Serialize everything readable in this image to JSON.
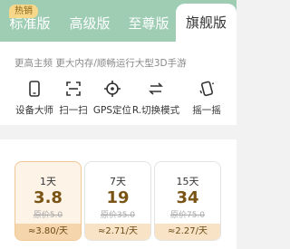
{
  "tabs": {
    "badge": "热销",
    "items": [
      "标准版",
      "高级版",
      "至尊版",
      "旗舰版"
    ],
    "active_index": 3
  },
  "info": {
    "tagline": "更高主频 更大内存/顺畅运行大型3D手游",
    "features": [
      {
        "label": "设备大师",
        "icon": "phone-icon"
      },
      {
        "label": "扫一扫",
        "icon": "scan-icon"
      },
      {
        "label": "GPS定位",
        "icon": "crosshair-icon"
      },
      {
        "label": "R.切换模式",
        "icon": "switch-icon"
      },
      {
        "label": "摇一摇",
        "icon": "shake-icon"
      }
    ]
  },
  "plans": [
    {
      "duration": "1天",
      "price": "3.8",
      "original": "原价5.0",
      "daily": "≈3.80/天",
      "selected": true
    },
    {
      "duration": "7天",
      "price": "19",
      "original": "原价35.0",
      "daily": "≈2.71/天",
      "selected": false
    },
    {
      "duration": "15天",
      "price": "34",
      "original": "原价75.0",
      "daily": "≈2.27/天",
      "selected": false
    }
  ],
  "colors": {
    "tab_bar": "#9ecdb4",
    "badge": "#f7d88a",
    "price_text": "#7a5415",
    "selected_plan_bg": "#fdf3e6"
  }
}
